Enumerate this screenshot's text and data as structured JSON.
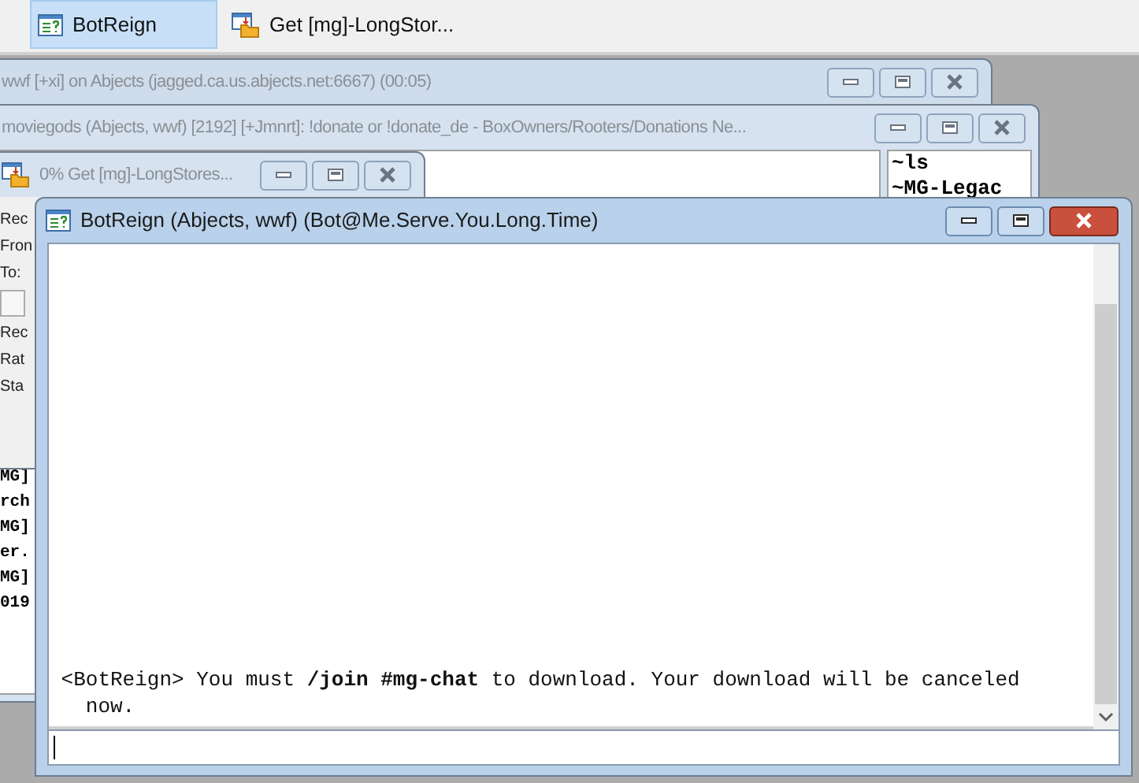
{
  "taskbar": {
    "buttons": [
      {
        "label": "BotReign",
        "kind": "query",
        "selected": true
      },
      {
        "label": "Get [mg]-LongStor...",
        "kind": "transfer",
        "selected": false
      }
    ]
  },
  "status_window": {
    "title": "wwf [+xi] on Abjects (jagged.ca.us.abjects.net:6667) (00:05)"
  },
  "channel_window": {
    "title": "moviegods (Abjects, wwf) [2192] [+Jmnrt]: !donate or !donate_de - BoxOwners/Rooters/Donations Ne...",
    "text_fragments": [
      "MG]",
      "rch",
      "MG]",
      "er.",
      "MG]",
      "019"
    ],
    "nicklist": [
      "~ls",
      "~MG-Legac"
    ]
  },
  "get_window": {
    "title": "0% Get [mg]-LongStores...",
    "labels": [
      "Rec",
      "Fron",
      "To:",
      "Rec",
      "Rat",
      "Sta"
    ]
  },
  "query_window": {
    "title": "BotReign (Abjects, wwf) (Bot@Me.Serve.You.Long.Time)",
    "active": true,
    "message": "<BotReign> You must **/join #mg-chat** to download. Your download will be canceled now."
  }
}
